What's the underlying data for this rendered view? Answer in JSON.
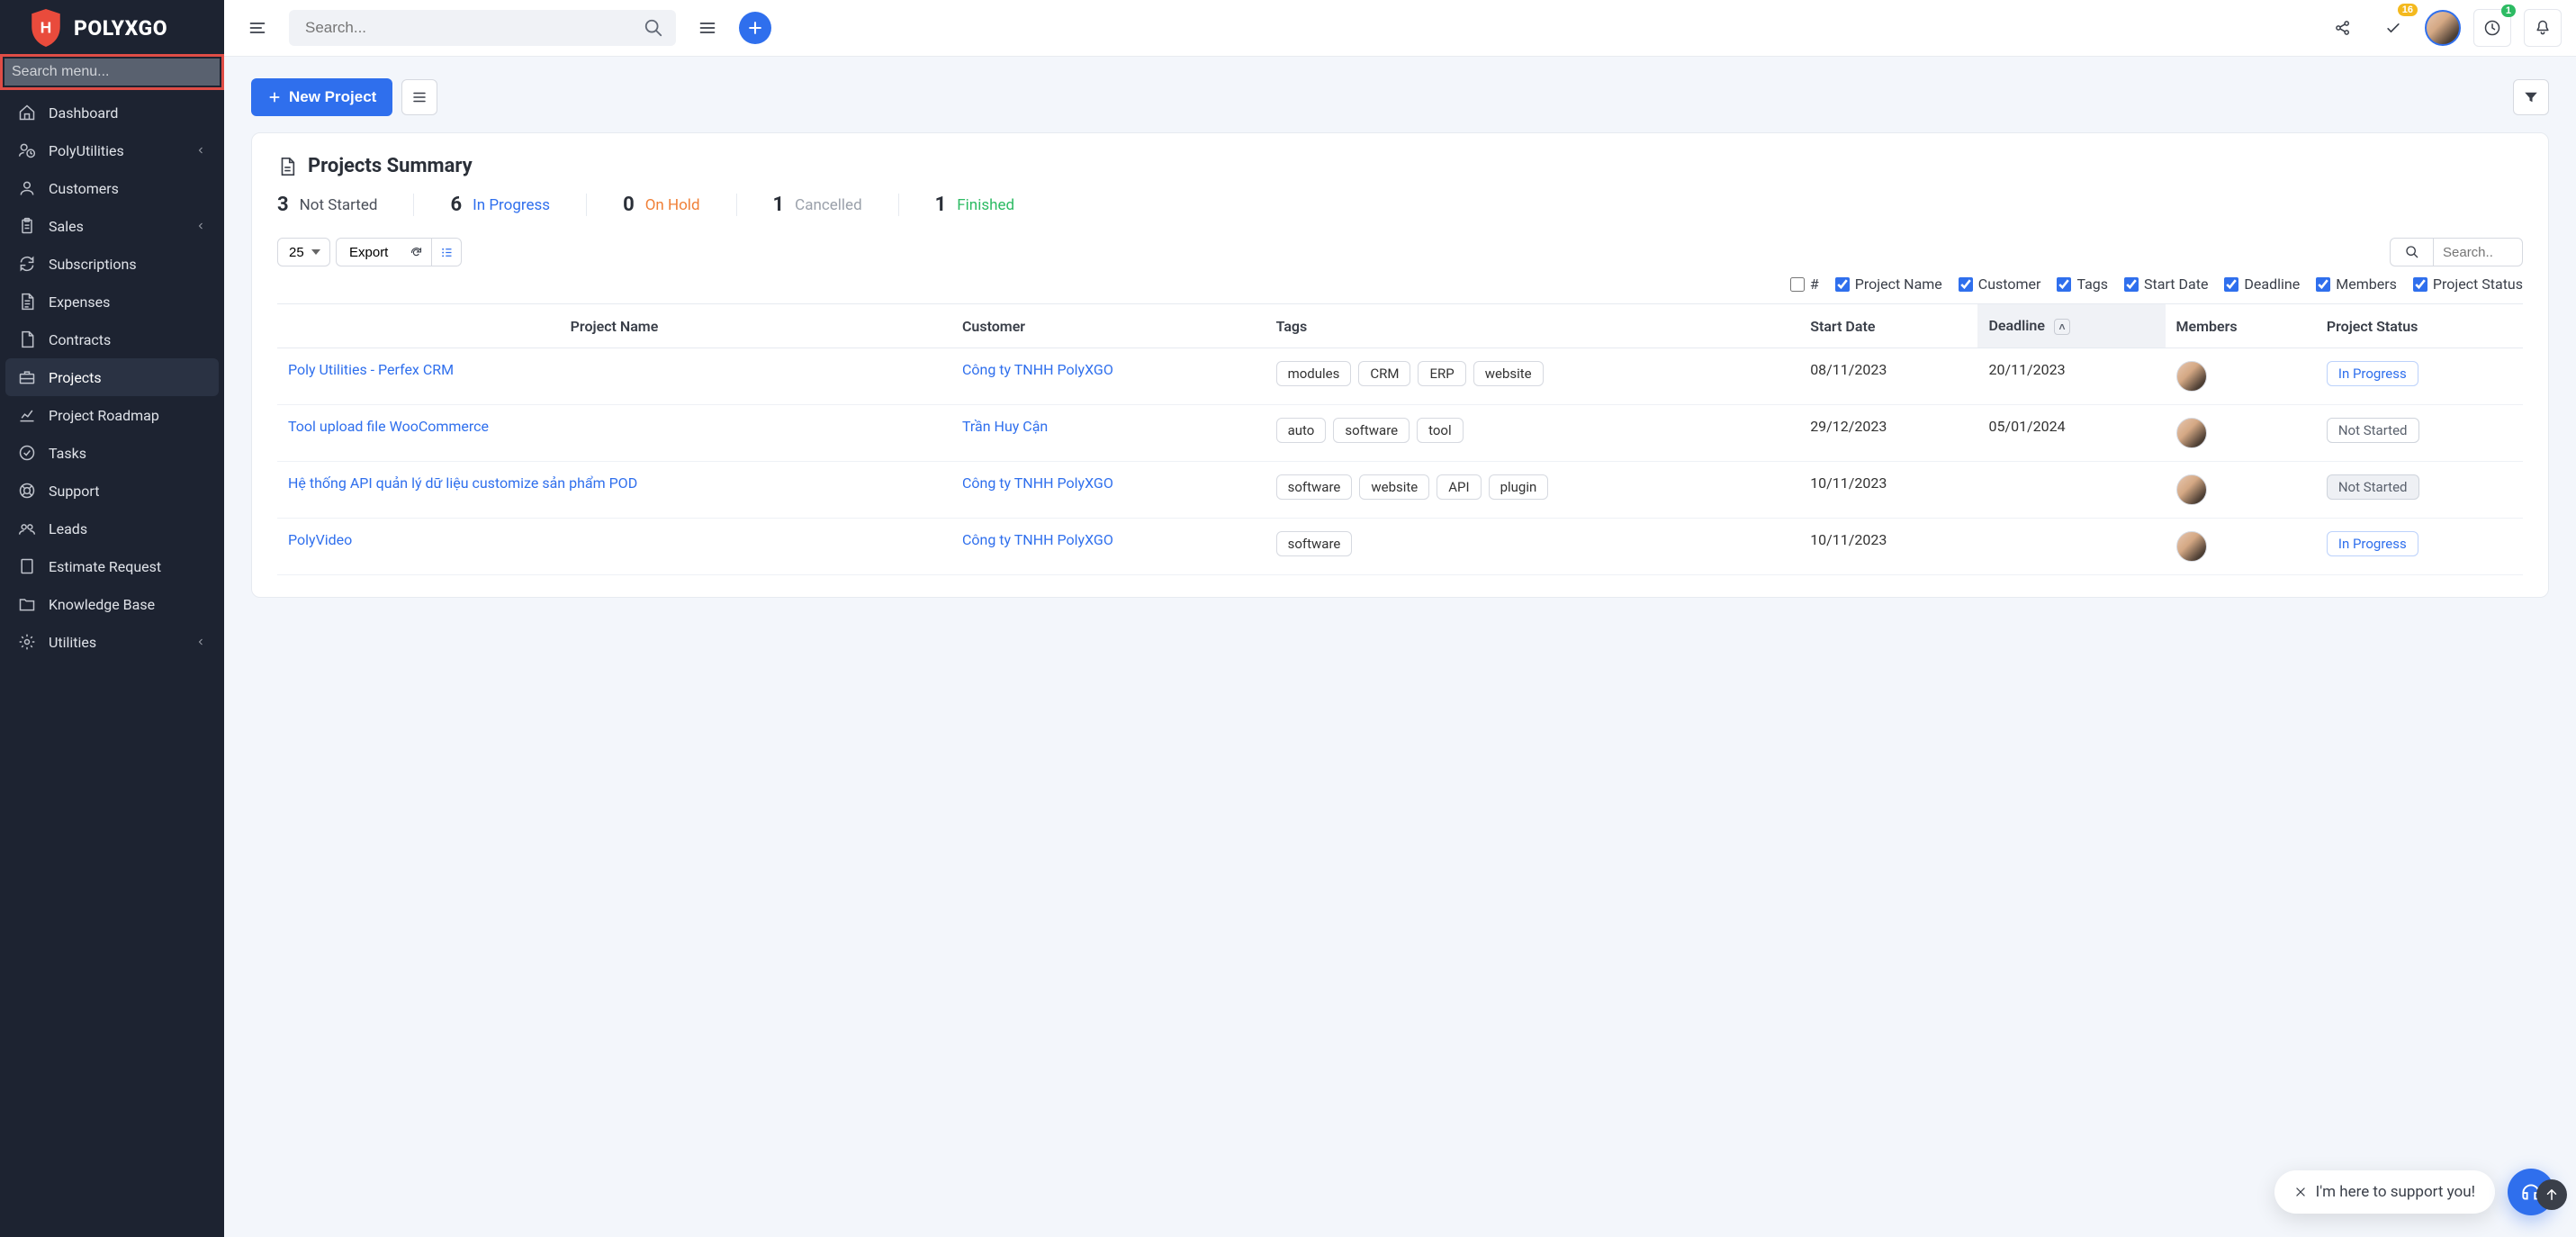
{
  "brand": {
    "name": "POLYXGO"
  },
  "sidebar": {
    "search_placeholder": "Search menu...",
    "items": [
      {
        "label": "Dashboard",
        "icon": "house-icon",
        "chevron": false
      },
      {
        "label": "PolyUtilities",
        "icon": "user-clock-icon",
        "chevron": true
      },
      {
        "label": "Customers",
        "icon": "user-icon",
        "chevron": false
      },
      {
        "label": "Sales",
        "icon": "clipboard-icon",
        "chevron": true
      },
      {
        "label": "Subscriptions",
        "icon": "refresh-icon",
        "chevron": false
      },
      {
        "label": "Expenses",
        "icon": "file-lines-icon",
        "chevron": false
      },
      {
        "label": "Contracts",
        "icon": "file-icon",
        "chevron": false
      },
      {
        "label": "Projects",
        "icon": "briefcase-icon",
        "chevron": false,
        "active": true
      },
      {
        "label": "Project Roadmap",
        "icon": "chart-line-icon",
        "chevron": false
      },
      {
        "label": "Tasks",
        "icon": "check-circle-icon",
        "chevron": false
      },
      {
        "label": "Support",
        "icon": "life-ring-icon",
        "chevron": false
      },
      {
        "label": "Leads",
        "icon": "people-icon",
        "chevron": false
      },
      {
        "label": "Estimate Request",
        "icon": "doc-icon",
        "chevron": false
      },
      {
        "label": "Knowledge Base",
        "icon": "folder-icon",
        "chevron": false
      },
      {
        "label": "Utilities",
        "icon": "gear-icon",
        "chevron": true
      }
    ]
  },
  "topbar": {
    "search_placeholder": "Search...",
    "notif_badge": "16",
    "clock_badge": "1"
  },
  "toolbar": {
    "new_project_label": "New Project"
  },
  "summary": {
    "title": "Projects Summary",
    "stats": [
      {
        "num": "3",
        "label": "Not Started",
        "cls": "cl-notstarted"
      },
      {
        "num": "6",
        "label": "In Progress",
        "cls": "cl-inprogress"
      },
      {
        "num": "0",
        "label": "On Hold",
        "cls": "cl-onhold"
      },
      {
        "num": "1",
        "label": "Cancelled",
        "cls": "cl-cancelled"
      },
      {
        "num": "1",
        "label": "Finished",
        "cls": "cl-finished"
      }
    ]
  },
  "table": {
    "page_size": "25",
    "export_label": "Export",
    "search_placeholder": "Search..",
    "col_toggles": [
      {
        "label": "#",
        "checked": false
      },
      {
        "label": "Project Name",
        "checked": true
      },
      {
        "label": "Customer",
        "checked": true
      },
      {
        "label": "Tags",
        "checked": true
      },
      {
        "label": "Start Date",
        "checked": true
      },
      {
        "label": "Deadline",
        "checked": true
      },
      {
        "label": "Members",
        "checked": true
      },
      {
        "label": "Project Status",
        "checked": true
      }
    ],
    "headers": {
      "project": "Project Name",
      "customer": "Customer",
      "tags": "Tags",
      "start": "Start Date",
      "deadline": "Deadline",
      "members": "Members",
      "status": "Project Status"
    },
    "rows": [
      {
        "project": "Poly Utilities - Perfex CRM",
        "customer": "Công ty TNHH PolyXGO",
        "tags": [
          "modules",
          "CRM",
          "ERP",
          "website"
        ],
        "start": "08/11/2023",
        "deadline": "20/11/2023",
        "status": "In Progress",
        "status_cls": "status-inprogress"
      },
      {
        "project": "Tool upload file WooCommerce",
        "customer": "Trần Huy Cận",
        "tags": [
          "auto",
          "software",
          "tool"
        ],
        "start": "29/12/2023",
        "deadline": "05/01/2024",
        "status": "Not Started",
        "status_cls": "status-notstarted"
      },
      {
        "project": "Hệ thống API quản lý dữ liệu customize sản phẩm POD",
        "customer": "Công ty TNHH PolyXGO",
        "tags": [
          "software",
          "website",
          "API",
          "plugin"
        ],
        "start": "10/11/2023",
        "deadline": "",
        "status": "Not Started",
        "status_cls": "status-notstarted flat"
      },
      {
        "project": "PolyVideo",
        "customer": "Công ty TNHH PolyXGO",
        "tags": [
          "software"
        ],
        "start": "10/11/2023",
        "deadline": "",
        "status": "In Progress",
        "status_cls": "status-inprogress"
      }
    ]
  },
  "chat": {
    "msg": "I'm here to support you!"
  }
}
